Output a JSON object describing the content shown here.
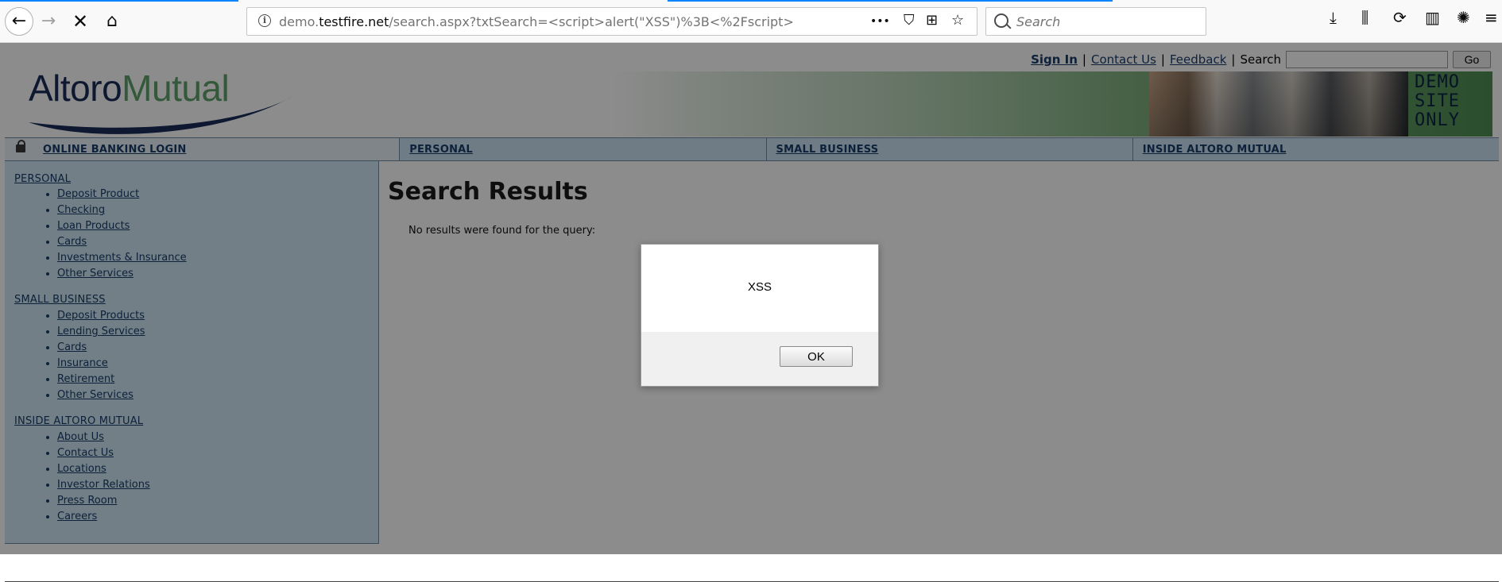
{
  "browser": {
    "url_prefix": "demo.",
    "url_domain": "testfire.net",
    "url_path": "/search.aspx?txtSearch=<script>alert(\"XSS\")%3B<%2Fscript>",
    "search_placeholder": "Search",
    "accent_color": "#0a84ff"
  },
  "icons": {
    "back": "←",
    "forward": "→",
    "stop": "✕",
    "home": "⌂",
    "more": "•••",
    "pocket": "⛉",
    "windows": "⊞",
    "star": "☆",
    "download": "⤓",
    "library": "⫼",
    "sync": "⟳",
    "sidebar": "▥",
    "extension": "✺",
    "menu": "≡"
  },
  "header": {
    "sign_in": "Sign In",
    "contact_us": "Contact Us",
    "feedback": "Feedback",
    "search_label": "Search",
    "go_button": "Go",
    "separator": "|",
    "logo_part1": "Altoro",
    "logo_part2": "Mutual",
    "banner_text": "DEMO SITE ONLY"
  },
  "mainnav": [
    {
      "label": "ONLINE BANKING LOGIN"
    },
    {
      "label": "PERSONAL"
    },
    {
      "label": "SMALL BUSINESS"
    },
    {
      "label": "INSIDE ALTORO MUTUAL"
    }
  ],
  "sidebar": {
    "personal": {
      "title": "PERSONAL",
      "items": [
        "Deposit Product",
        "Checking",
        "Loan Products",
        "Cards",
        "Investments & Insurance",
        "Other Services"
      ]
    },
    "small_business": {
      "title": "SMALL BUSINESS",
      "items": [
        "Deposit Products",
        "Lending Services",
        "Cards",
        "Insurance",
        "Retirement",
        "Other Services"
      ]
    },
    "inside": {
      "title": "INSIDE ALTORO MUTUAL",
      "items": [
        "About Us",
        "Contact Us",
        "Locations",
        "Investor Relations",
        "Press Room",
        "Careers"
      ]
    }
  },
  "content": {
    "title": "Search Results",
    "message": "No results were found for the query:"
  },
  "dialog": {
    "message": "XSS",
    "ok_label": "OK"
  }
}
